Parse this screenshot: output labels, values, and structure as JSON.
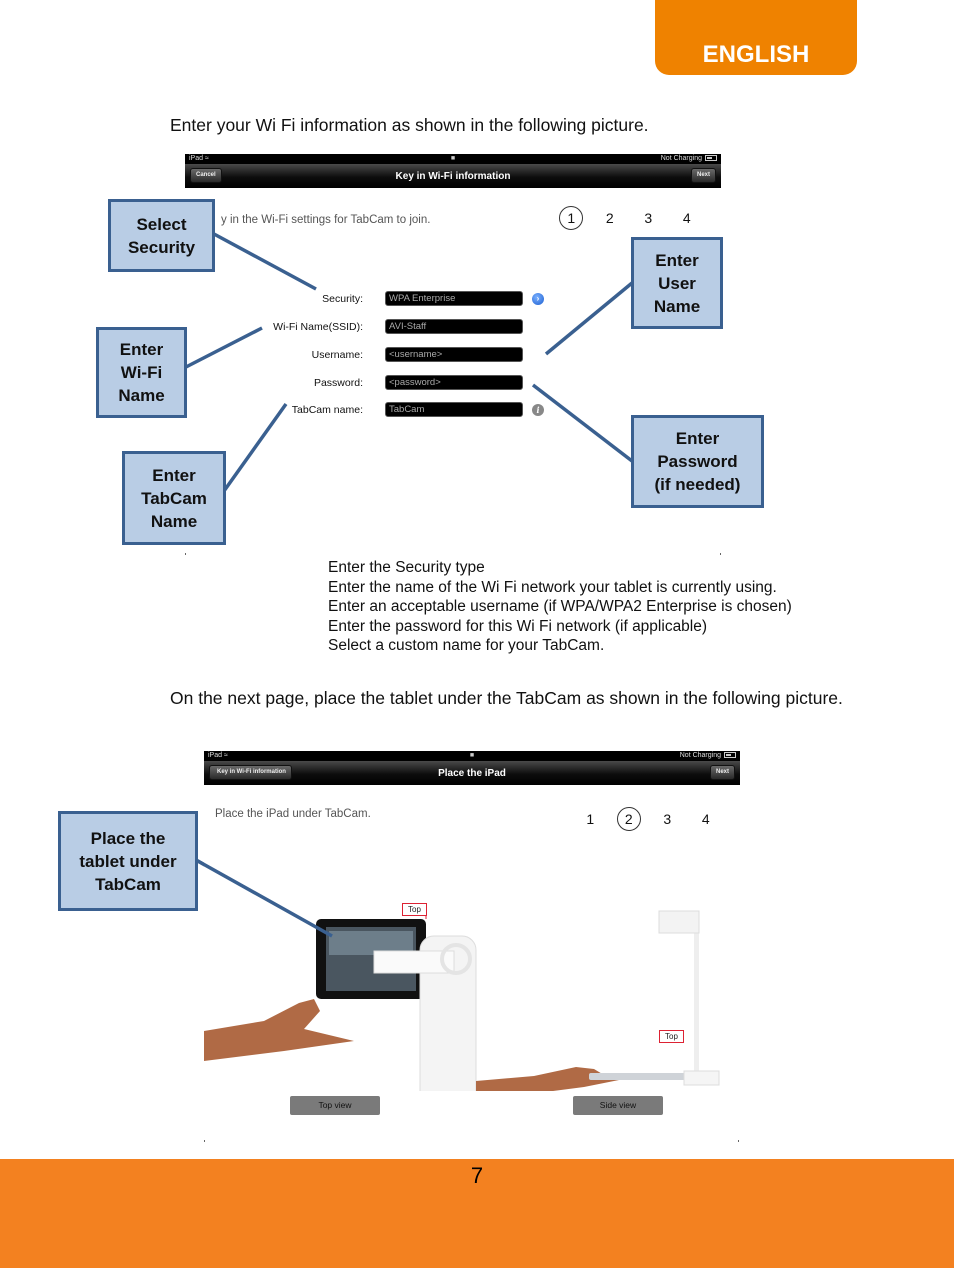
{
  "header": {
    "language_tab": "ENGLISH"
  },
  "intro_text": "Enter your Wi Fi information as shown in the following picture.",
  "screen1": {
    "statusbar": {
      "device": "iPad",
      "charging": "Not Charging"
    },
    "navbar": {
      "title": "Key in Wi-Fi information",
      "left_button": "Cancel",
      "right_button": "Next"
    },
    "instruction": "y in the Wi-Fi settings for TabCam to join.",
    "steps": [
      {
        "label": "1",
        "active": true
      },
      {
        "label": "2",
        "active": false
      },
      {
        "label": "3",
        "active": false
      },
      {
        "label": "4",
        "active": false
      }
    ],
    "form": [
      {
        "label": "Security:",
        "value": "WPA Enterprise",
        "icon": "disclosure-arrow-icon"
      },
      {
        "label": "Wi-Fi Name(SSID):",
        "value": "AVI-Staff",
        "icon": ""
      },
      {
        "label": "Username:",
        "value": "<username>",
        "icon": ""
      },
      {
        "label": "Password:",
        "value": "<password>",
        "icon": ""
      },
      {
        "label": "TabCam name:",
        "value": "TabCam",
        "icon": "info-icon"
      }
    ]
  },
  "callouts": {
    "select_security": [
      "Select",
      "Security"
    ],
    "enter_wifi_name": [
      "Enter",
      "Wi-Fi",
      "Name"
    ],
    "enter_tabcam_name": [
      "Enter",
      "TabCam",
      "Name"
    ],
    "enter_user_name": [
      "Enter",
      "User",
      "Name"
    ],
    "enter_password": [
      "Enter",
      "Password",
      "(if needed)"
    ],
    "place_tablet": [
      "Place the",
      "tablet under",
      "TabCam"
    ]
  },
  "field_descriptions": [
    "Enter the Security type",
    "Enter the name of the Wi Fi network your tablet is currently using.",
    "Enter an acceptable username (if WPA/WPA2 Enterprise is chosen)",
    "Enter the password for this Wi Fi network (if applicable)",
    "Select a custom name for your TabCam."
  ],
  "next_page_text": "On the next page, place the tablet under the TabCam as shown in the following picture.",
  "screen2": {
    "statusbar": {
      "device": "iPad",
      "charging": "Not Charging"
    },
    "navbar": {
      "title": "Place the iPad",
      "back_button": "Key in Wi-Fi information",
      "right_button": "Next"
    },
    "instruction": "Place the iPad under TabCam.",
    "steps": [
      {
        "label": "1",
        "active": false
      },
      {
        "label": "2",
        "active": true
      },
      {
        "label": "3",
        "active": false
      },
      {
        "label": "4",
        "active": false
      }
    ],
    "top_tag_label": "Top",
    "top_view_button": "Top view",
    "side_view_button": "Side view"
  },
  "footer": {
    "page_number": "7"
  },
  "colors": {
    "brand_orange": "#f38120",
    "tab_orange": "#ef8200",
    "callout_fill": "#b9cde5",
    "callout_border": "#3a6090"
  }
}
